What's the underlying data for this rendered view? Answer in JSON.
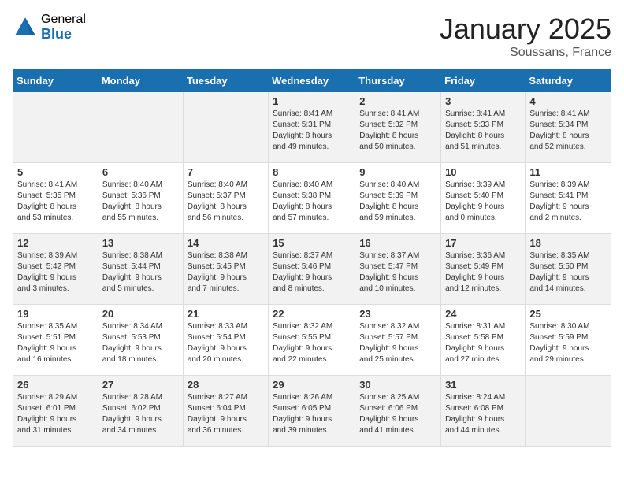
{
  "header": {
    "logo_general": "General",
    "logo_blue": "Blue",
    "title": "January 2025",
    "location": "Soussans, France"
  },
  "weekdays": [
    "Sunday",
    "Monday",
    "Tuesday",
    "Wednesday",
    "Thursday",
    "Friday",
    "Saturday"
  ],
  "weeks": [
    [
      {
        "day": "",
        "info": ""
      },
      {
        "day": "",
        "info": ""
      },
      {
        "day": "",
        "info": ""
      },
      {
        "day": "1",
        "info": "Sunrise: 8:41 AM\nSunset: 5:31 PM\nDaylight: 8 hours\nand 49 minutes."
      },
      {
        "day": "2",
        "info": "Sunrise: 8:41 AM\nSunset: 5:32 PM\nDaylight: 8 hours\nand 50 minutes."
      },
      {
        "day": "3",
        "info": "Sunrise: 8:41 AM\nSunset: 5:33 PM\nDaylight: 8 hours\nand 51 minutes."
      },
      {
        "day": "4",
        "info": "Sunrise: 8:41 AM\nSunset: 5:34 PM\nDaylight: 8 hours\nand 52 minutes."
      }
    ],
    [
      {
        "day": "5",
        "info": "Sunrise: 8:41 AM\nSunset: 5:35 PM\nDaylight: 8 hours\nand 53 minutes."
      },
      {
        "day": "6",
        "info": "Sunrise: 8:40 AM\nSunset: 5:36 PM\nDaylight: 8 hours\nand 55 minutes."
      },
      {
        "day": "7",
        "info": "Sunrise: 8:40 AM\nSunset: 5:37 PM\nDaylight: 8 hours\nand 56 minutes."
      },
      {
        "day": "8",
        "info": "Sunrise: 8:40 AM\nSunset: 5:38 PM\nDaylight: 8 hours\nand 57 minutes."
      },
      {
        "day": "9",
        "info": "Sunrise: 8:40 AM\nSunset: 5:39 PM\nDaylight: 8 hours\nand 59 minutes."
      },
      {
        "day": "10",
        "info": "Sunrise: 8:39 AM\nSunset: 5:40 PM\nDaylight: 9 hours\nand 0 minutes."
      },
      {
        "day": "11",
        "info": "Sunrise: 8:39 AM\nSunset: 5:41 PM\nDaylight: 9 hours\nand 2 minutes."
      }
    ],
    [
      {
        "day": "12",
        "info": "Sunrise: 8:39 AM\nSunset: 5:42 PM\nDaylight: 9 hours\nand 3 minutes."
      },
      {
        "day": "13",
        "info": "Sunrise: 8:38 AM\nSunset: 5:44 PM\nDaylight: 9 hours\nand 5 minutes."
      },
      {
        "day": "14",
        "info": "Sunrise: 8:38 AM\nSunset: 5:45 PM\nDaylight: 9 hours\nand 7 minutes."
      },
      {
        "day": "15",
        "info": "Sunrise: 8:37 AM\nSunset: 5:46 PM\nDaylight: 9 hours\nand 8 minutes."
      },
      {
        "day": "16",
        "info": "Sunrise: 8:37 AM\nSunset: 5:47 PM\nDaylight: 9 hours\nand 10 minutes."
      },
      {
        "day": "17",
        "info": "Sunrise: 8:36 AM\nSunset: 5:49 PM\nDaylight: 9 hours\nand 12 minutes."
      },
      {
        "day": "18",
        "info": "Sunrise: 8:35 AM\nSunset: 5:50 PM\nDaylight: 9 hours\nand 14 minutes."
      }
    ],
    [
      {
        "day": "19",
        "info": "Sunrise: 8:35 AM\nSunset: 5:51 PM\nDaylight: 9 hours\nand 16 minutes."
      },
      {
        "day": "20",
        "info": "Sunrise: 8:34 AM\nSunset: 5:53 PM\nDaylight: 9 hours\nand 18 minutes."
      },
      {
        "day": "21",
        "info": "Sunrise: 8:33 AM\nSunset: 5:54 PM\nDaylight: 9 hours\nand 20 minutes."
      },
      {
        "day": "22",
        "info": "Sunrise: 8:32 AM\nSunset: 5:55 PM\nDaylight: 9 hours\nand 22 minutes."
      },
      {
        "day": "23",
        "info": "Sunrise: 8:32 AM\nSunset: 5:57 PM\nDaylight: 9 hours\nand 25 minutes."
      },
      {
        "day": "24",
        "info": "Sunrise: 8:31 AM\nSunset: 5:58 PM\nDaylight: 9 hours\nand 27 minutes."
      },
      {
        "day": "25",
        "info": "Sunrise: 8:30 AM\nSunset: 5:59 PM\nDaylight: 9 hours\nand 29 minutes."
      }
    ],
    [
      {
        "day": "26",
        "info": "Sunrise: 8:29 AM\nSunset: 6:01 PM\nDaylight: 9 hours\nand 31 minutes."
      },
      {
        "day": "27",
        "info": "Sunrise: 8:28 AM\nSunset: 6:02 PM\nDaylight: 9 hours\nand 34 minutes."
      },
      {
        "day": "28",
        "info": "Sunrise: 8:27 AM\nSunset: 6:04 PM\nDaylight: 9 hours\nand 36 minutes."
      },
      {
        "day": "29",
        "info": "Sunrise: 8:26 AM\nSunset: 6:05 PM\nDaylight: 9 hours\nand 39 minutes."
      },
      {
        "day": "30",
        "info": "Sunrise: 8:25 AM\nSunset: 6:06 PM\nDaylight: 9 hours\nand 41 minutes."
      },
      {
        "day": "31",
        "info": "Sunrise: 8:24 AM\nSunset: 6:08 PM\nDaylight: 9 hours\nand 44 minutes."
      },
      {
        "day": "",
        "info": ""
      }
    ]
  ]
}
